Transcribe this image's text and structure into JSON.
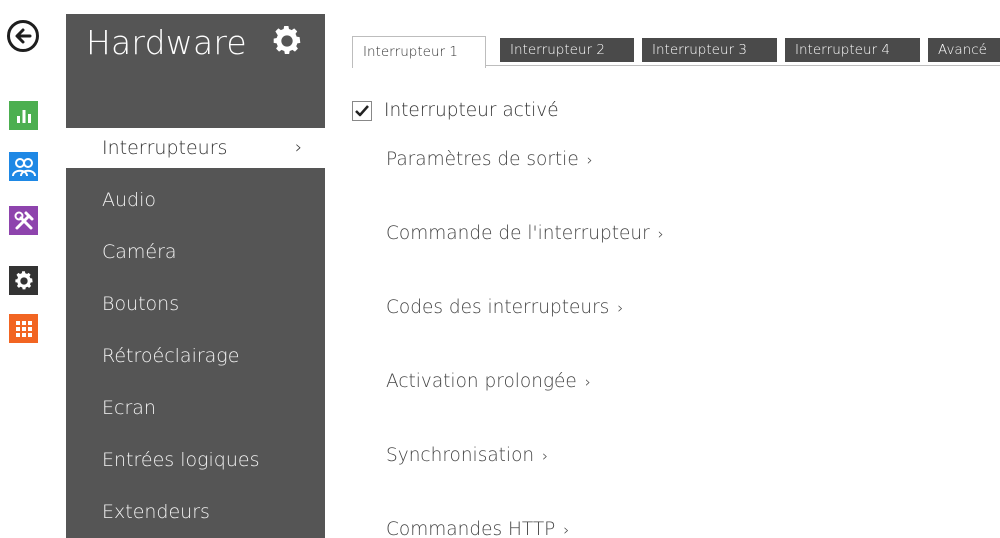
{
  "sidebar": {
    "title": "Hardware",
    "items": [
      {
        "label": "Interrupteurs",
        "active": true,
        "chevron": "›"
      },
      {
        "label": "Audio"
      },
      {
        "label": "Caméra"
      },
      {
        "label": "Boutons"
      },
      {
        "label": "Rétroéclairage"
      },
      {
        "label": "Ecran"
      },
      {
        "label": "Entrées logiques"
      },
      {
        "label": "Extendeurs"
      }
    ]
  },
  "rail": {
    "icons": [
      {
        "name": "back-arrow-icon"
      },
      {
        "name": "status-chart-icon",
        "color": "#4caf50"
      },
      {
        "name": "directory-users-icon",
        "color": "#1e88e5"
      },
      {
        "name": "services-tools-icon",
        "color": "#8e44ad"
      },
      {
        "name": "hardware-gear-icon",
        "color": "#333333"
      },
      {
        "name": "system-grid-icon",
        "color": "#f26522"
      }
    ]
  },
  "tabs": [
    {
      "label": "Interrupteur 1",
      "active": true
    },
    {
      "label": "Interrupteur 2"
    },
    {
      "label": "Interrupteur 3"
    },
    {
      "label": "Interrupteur 4"
    },
    {
      "label": "Avancé"
    }
  ],
  "content": {
    "enabled_checkbox": {
      "label": "Interrupteur activé",
      "checked": true
    },
    "sections": [
      {
        "label": "Paramètres de sortie",
        "arrow": "›"
      },
      {
        "label": "Commande de l'interrupteur",
        "arrow": "›"
      },
      {
        "label": "Codes des interrupteurs",
        "arrow": "›"
      },
      {
        "label": "Activation prolongée",
        "arrow": "›"
      },
      {
        "label": "Synchronisation",
        "arrow": "›"
      },
      {
        "label": "Commandes HTTP",
        "arrow": "›"
      }
    ]
  }
}
